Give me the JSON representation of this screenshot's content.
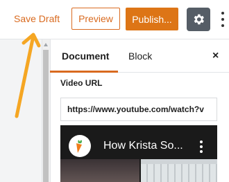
{
  "toolbar": {
    "save_draft_label": "Save Draft",
    "preview_label": "Preview",
    "publish_label": "Publish..."
  },
  "sidebar": {
    "tabs": [
      {
        "label": "Document",
        "active": true
      },
      {
        "label": "Block",
        "active": false
      }
    ],
    "close_label": "×",
    "video_url_label": "Video URL",
    "video_url_value": "https://www.youtube.com/watch?v",
    "video_preview": {
      "title": "How Krista So..."
    }
  },
  "colors": {
    "accent": "#d96a1f",
    "publish_bg": "#dd7516",
    "settings_bg": "#555d66",
    "annotation_arrow": "#f5a623"
  },
  "icons": {
    "settings": "gear-icon",
    "more": "vertical-ellipsis-icon",
    "channel": "carrot-avatar-icon",
    "video_menu": "vertical-ellipsis-icon"
  }
}
